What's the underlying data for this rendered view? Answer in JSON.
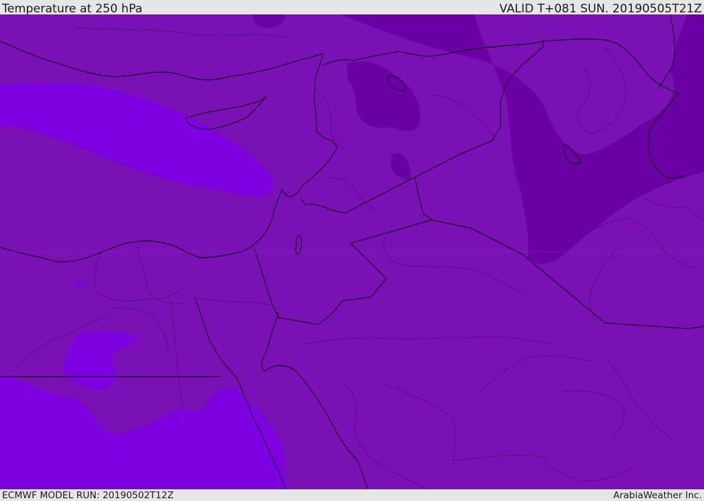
{
  "header": {
    "title": "Temperature at 250 hPa",
    "valid_time": "VALID T+081 SUN. 20190505T21Z"
  },
  "footer": {
    "model_run": "ECMWF MODEL RUN: 20190502T12Z",
    "credit": "ArabiaWeather Inc."
  },
  "map": {
    "colors": {
      "base": "#7a11b5",
      "warm_band": "#7e00e0",
      "cold_band": "#6a00a3",
      "border": "#000000"
    }
  }
}
